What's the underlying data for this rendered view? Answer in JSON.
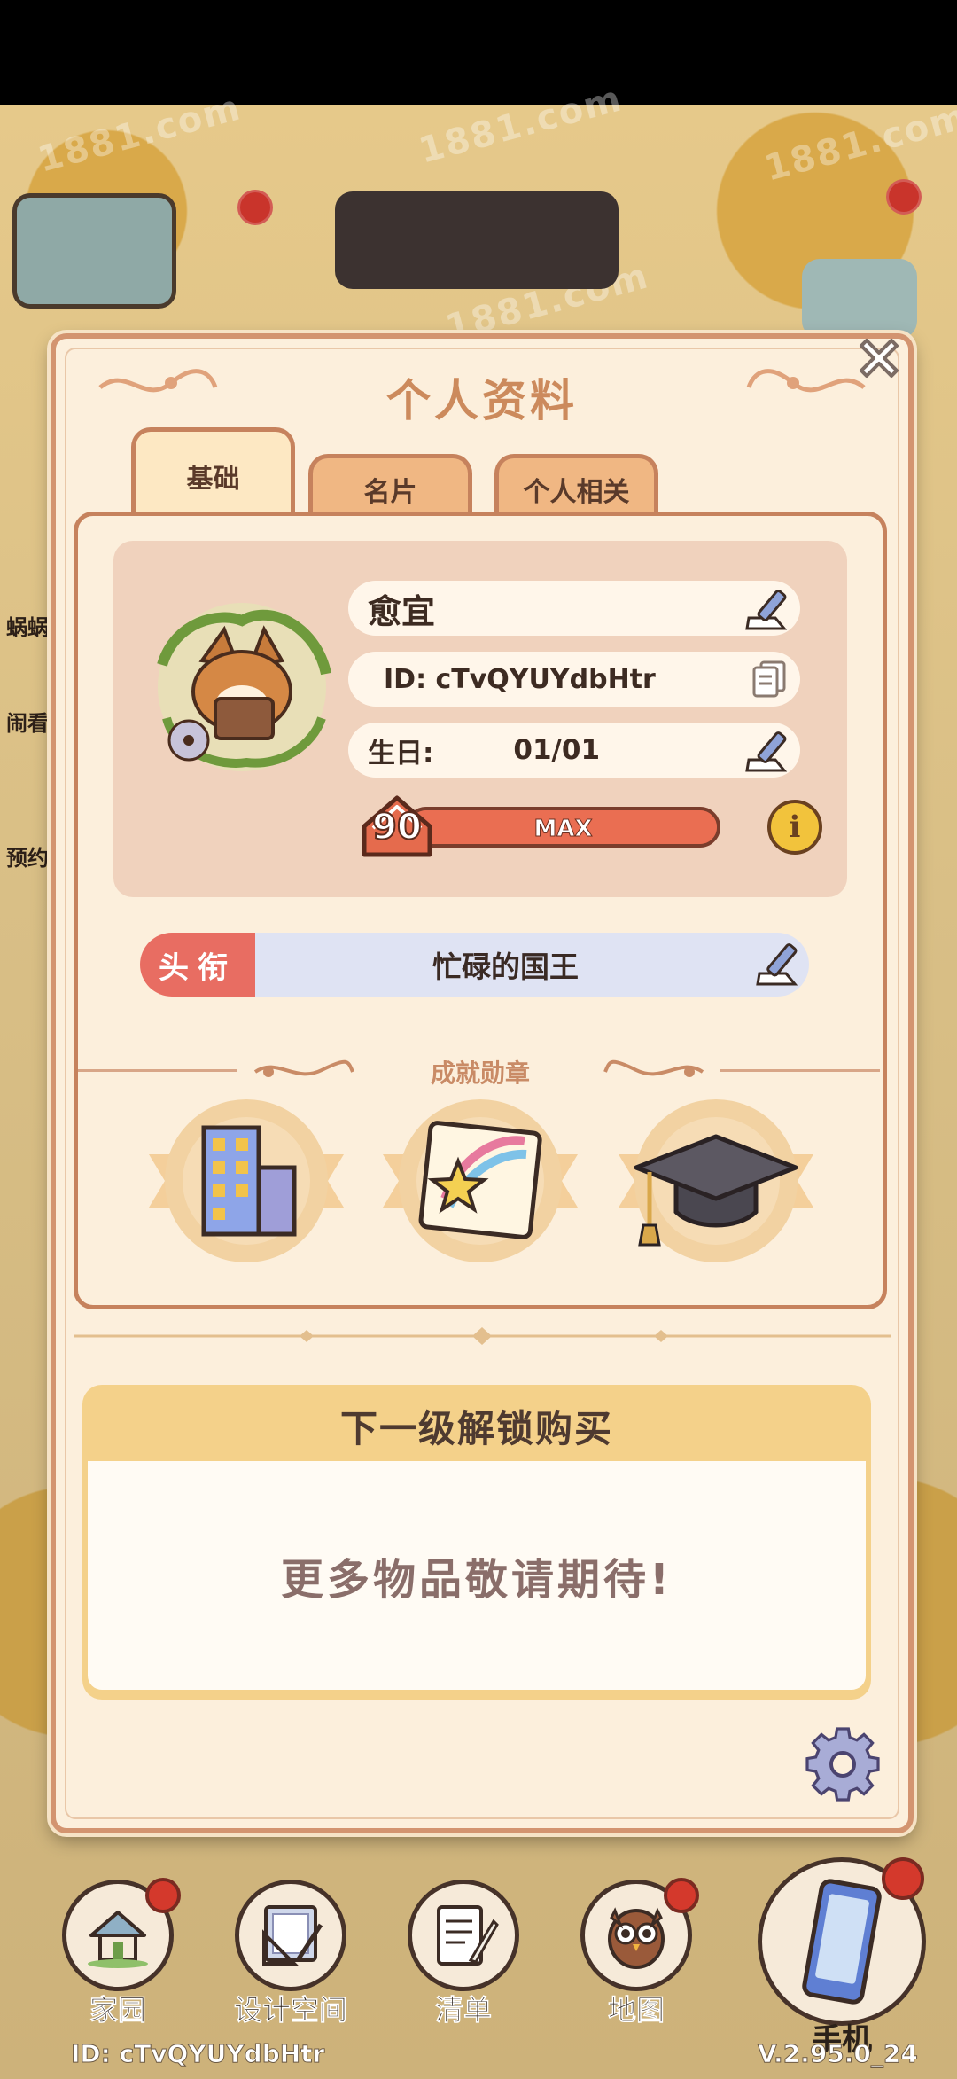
{
  "panel": {
    "title": "个人资料",
    "tabs": [
      {
        "label": "基础",
        "active": true
      },
      {
        "label": "名片",
        "active": false
      },
      {
        "label": "个人相关",
        "active": false
      }
    ]
  },
  "profile": {
    "name": "愈宜",
    "id_text": "ID: cTvQYUYdbHtr",
    "birthday_label": "生日:",
    "birthday_value": "01/01",
    "level": "90",
    "level_status": "MAX",
    "level_fill": 1.0
  },
  "title_row": {
    "label": "头衔",
    "value": "忙碌的国王"
  },
  "achievements": {
    "heading": "成就勋章",
    "medals": [
      "building-medal-icon",
      "shooting-star-scroll-icon",
      "graduation-cap-icon"
    ]
  },
  "unlock": {
    "header": "下一级解锁购买",
    "body": "更多物品敬请期待!"
  },
  "side_labels": [
    "蜗蜗",
    "闹看",
    "预约"
  ],
  "nav": [
    {
      "label": "家园",
      "icon": "home-icon",
      "badge": true
    },
    {
      "label": "设计空间",
      "icon": "design-tools-icon",
      "badge": false
    },
    {
      "label": "清单",
      "icon": "checklist-icon",
      "badge": false
    },
    {
      "label": "地图",
      "icon": "owl-map-icon",
      "badge": true
    },
    {
      "label": "手机",
      "icon": "phone-icon",
      "badge": true
    }
  ],
  "footer": {
    "id": "ID: cTvQYUYdbHtr",
    "version": "V.2.95.0_24"
  },
  "watermark": "1881.com",
  "colors": {
    "panel_bg": "#fcefdc",
    "panel_border": "#d39470",
    "title_color": "#cc8a5c",
    "level_bar": "#e56b4d",
    "title_label": "#e86d62",
    "title_value_bg": "#dfe3f3",
    "unlock_header_bg": "#f4d18a"
  }
}
